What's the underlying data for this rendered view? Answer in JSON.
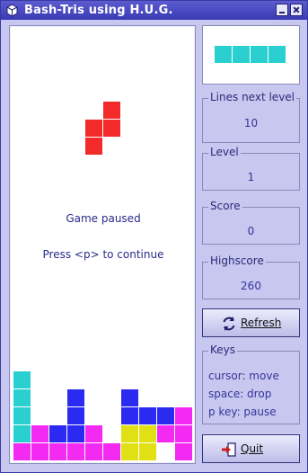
{
  "window": {
    "title": "Bash-Tris using H.U.G.",
    "min_label": "minimize",
    "close_label": "close"
  },
  "board": {
    "paused_text": "Game paused",
    "continue_text": "Press <p> to continue",
    "colors": {
      "red": "#f22a2a",
      "cyan": "#2acfcf",
      "blue": "#2a2af0",
      "magenta": "#f22af2",
      "yellow": "#e0e014"
    },
    "falling_piece": {
      "color": "red",
      "cells": [
        [
          5,
          4
        ],
        [
          5,
          5
        ],
        [
          4,
          5
        ],
        [
          4,
          6
        ]
      ]
    },
    "stack": [
      {
        "col": 0,
        "row": 19,
        "color": "cyan"
      },
      {
        "col": 0,
        "row": 20,
        "color": "cyan"
      },
      {
        "col": 0,
        "row": 21,
        "color": "cyan"
      },
      {
        "col": 0,
        "row": 22,
        "color": "cyan"
      },
      {
        "col": 0,
        "row": 23,
        "color": "magenta"
      },
      {
        "col": 1,
        "row": 22,
        "color": "magenta"
      },
      {
        "col": 1,
        "row": 23,
        "color": "magenta"
      },
      {
        "col": 2,
        "row": 22,
        "color": "blue"
      },
      {
        "col": 2,
        "row": 23,
        "color": "magenta"
      },
      {
        "col": 3,
        "row": 20,
        "color": "blue"
      },
      {
        "col": 3,
        "row": 21,
        "color": "blue"
      },
      {
        "col": 3,
        "row": 22,
        "color": "blue"
      },
      {
        "col": 3,
        "row": 23,
        "color": "magenta"
      },
      {
        "col": 4,
        "row": 22,
        "color": "magenta"
      },
      {
        "col": 4,
        "row": 23,
        "color": "magenta"
      },
      {
        "col": 5,
        "row": 23,
        "color": "magenta"
      },
      {
        "col": 6,
        "row": 20,
        "color": "blue"
      },
      {
        "col": 6,
        "row": 21,
        "color": "blue"
      },
      {
        "col": 6,
        "row": 22,
        "color": "yellow"
      },
      {
        "col": 6,
        "row": 23,
        "color": "yellow"
      },
      {
        "col": 7,
        "row": 21,
        "color": "blue"
      },
      {
        "col": 7,
        "row": 22,
        "color": "yellow"
      },
      {
        "col": 7,
        "row": 23,
        "color": "yellow"
      },
      {
        "col": 8,
        "row": 21,
        "color": "blue"
      },
      {
        "col": 8,
        "row": 22,
        "color": "magenta"
      },
      {
        "col": 9,
        "row": 21,
        "color": "magenta"
      },
      {
        "col": 9,
        "row": 22,
        "color": "magenta"
      },
      {
        "col": 9,
        "row": 23,
        "color": "magenta"
      }
    ]
  },
  "next_piece": {
    "color": "cyan",
    "cells": 4
  },
  "stats": {
    "lines_next_level": {
      "label": "Lines next level",
      "value": "10"
    },
    "level": {
      "label": "Level",
      "value": "1"
    },
    "score": {
      "label": "Score",
      "value": "0"
    },
    "highscore": {
      "label": "Highscore",
      "value": "260"
    }
  },
  "buttons": {
    "refresh": "Refresh",
    "quit": "Quit"
  },
  "keys": {
    "label": "Keys",
    "lines": [
      "cursor: move",
      "space: drop",
      "p key: pause"
    ]
  }
}
